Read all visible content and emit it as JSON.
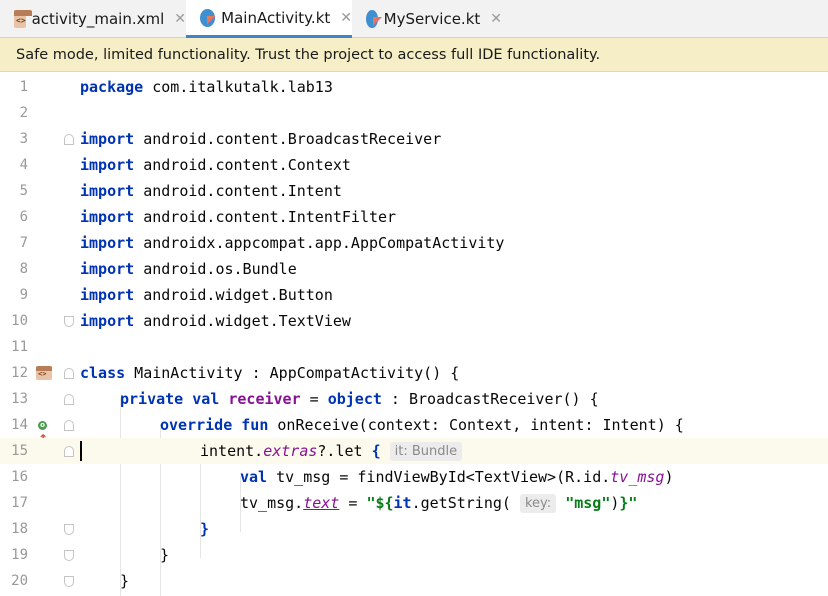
{
  "tabs": [
    {
      "label": "activity_main.xml",
      "icon": "xml-file-icon",
      "active": false
    },
    {
      "label": "MainActivity.kt",
      "icon": "kotlin-class-icon",
      "active": true
    },
    {
      "label": "MyService.kt",
      "icon": "kotlin-class-icon",
      "active": false
    }
  ],
  "tab_close_glyph": "✕",
  "banner": "Safe mode, limited functionality. Trust the project to access full IDE functionality.",
  "current_line": 15,
  "lines": [
    {
      "n": "1"
    },
    {
      "n": "2"
    },
    {
      "n": "3"
    },
    {
      "n": "4"
    },
    {
      "n": "5"
    },
    {
      "n": "6"
    },
    {
      "n": "7"
    },
    {
      "n": "8"
    },
    {
      "n": "9"
    },
    {
      "n": "10"
    },
    {
      "n": "11"
    },
    {
      "n": "12"
    },
    {
      "n": "13"
    },
    {
      "n": "14"
    },
    {
      "n": "15"
    },
    {
      "n": "16"
    },
    {
      "n": "17"
    },
    {
      "n": "18"
    },
    {
      "n": "19"
    },
    {
      "n": "20"
    }
  ],
  "code": {
    "l1": {
      "kw": "package",
      "rest": " com.italkutalk.lab13"
    },
    "l3": {
      "kw": "import",
      "rest": " android.content.BroadcastReceiver"
    },
    "l4": {
      "kw": "import",
      "rest": " android.content.Context"
    },
    "l5": {
      "kw": "import",
      "rest": " android.content.Intent"
    },
    "l6": {
      "kw": "import",
      "rest": " android.content.IntentFilter"
    },
    "l7": {
      "kw": "import",
      "rest": " androidx.appcompat.app.AppCompatActivity"
    },
    "l8": {
      "kw": "import",
      "rest": " android.os.Bundle"
    },
    "l9": {
      "kw": "import",
      "rest": " android.widget.Button"
    },
    "l10": {
      "kw": "import",
      "rest": " android.widget.TextView"
    },
    "l12": {
      "kw": "class",
      "rest": " MainActivity : AppCompatActivity() {"
    },
    "l13": {
      "kw1": "private val",
      "fld": "receiver",
      "mid": " = ",
      "kw2": "object",
      "rest": " : BroadcastReceiver() {"
    },
    "l14": {
      "kw": "override fun",
      "rest": " onReceive(context: Context, intent: Intent) {"
    },
    "l15": {
      "a": "intent.",
      "ext": "extras",
      "b": "?.let ",
      "brace": "{",
      "hint": "it: Bundle"
    },
    "l16": {
      "kw": "val",
      "a": " tv_msg = findViewById<TextView>(R.id.",
      "id": "tv_msg",
      "b": ")"
    },
    "l17": {
      "a": "tv_msg.",
      "text": "text",
      "b": " = ",
      "s1": "\"${",
      "it": "it",
      "b2": ".getString(",
      "hint": "key:",
      "s2": "\"msg\"",
      "b3": ")",
      "s3": "}\""
    },
    "l18": {
      "a": "}"
    },
    "l19": {
      "a": "}"
    },
    "l20": {
      "a": "}"
    }
  },
  "gutter_icons": {
    "l12": "class-layout-icon",
    "l14": "override-method-icon"
  },
  "colors": {
    "keyword": "#0033b3",
    "field": "#871094",
    "string": "#067d17",
    "banner_bg": "#f5eec6",
    "current_line_bg": "#fcfaed",
    "tab_accent": "#4083c9"
  }
}
